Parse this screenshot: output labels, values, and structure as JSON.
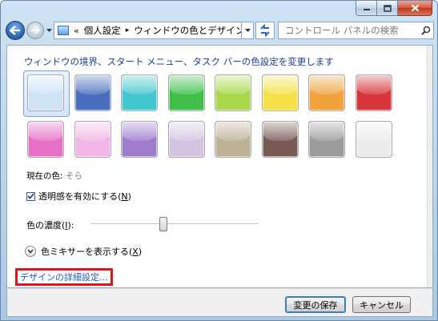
{
  "window": {
    "caption_buttons": [
      "minimize-icon",
      "maximize-icon",
      "close-icon"
    ]
  },
  "nav": {
    "breadcrumb_overflow": "«",
    "crumbs": [
      "個人設定",
      "ウィンドウの色とデザイン"
    ],
    "crumb_separator": "▸",
    "search_placeholder": "コントロール パネルの検索"
  },
  "content": {
    "heading": "ウィンドウの境界、スタート メニュー、タスク バーの色設定を変更します",
    "swatches": [
      {
        "name": "sky",
        "color": "#cfe3f7",
        "selected": true
      },
      {
        "name": "twilight",
        "color": "#4a6fc0"
      },
      {
        "name": "sea",
        "color": "#42c6cf"
      },
      {
        "name": "leaf",
        "color": "#3fbf4a"
      },
      {
        "name": "lime",
        "color": "#a8d84a"
      },
      {
        "name": "lemon",
        "color": "#f5e24a"
      },
      {
        "name": "orange",
        "color": "#f0a23c"
      },
      {
        "name": "ruby",
        "color": "#d7353b"
      },
      {
        "name": "fuchsia",
        "color": "#e76fc6"
      },
      {
        "name": "blush",
        "color": "#f1b6e6"
      },
      {
        "name": "violet",
        "color": "#9d7ccc"
      },
      {
        "name": "lavender",
        "color": "#d4c4e2"
      },
      {
        "name": "taupe",
        "color": "#bdb196"
      },
      {
        "name": "chocolate",
        "color": "#7a5a55"
      },
      {
        "name": "slate",
        "color": "#9b9b9b"
      },
      {
        "name": "frost",
        "color": "#ececec"
      }
    ],
    "current_color_label": "現在の色:",
    "current_color_value": "そら",
    "transparency_label": "透明感を有効にする(",
    "transparency_key": "N",
    "transparency_checked": true,
    "intensity_label": "色の濃度(",
    "intensity_key": "I",
    "intensity_level": 0.43,
    "mixer_label": "色ミキサーを表示する(",
    "mixer_key": "X",
    "advanced_link": "デザインの詳細設定..."
  },
  "footer": {
    "save_label": "変更の保存",
    "cancel_label": "キャンセル"
  },
  "colors": {
    "link": "#1a5fc7",
    "heading": "#1e3f96",
    "highlight_box": "#e0141b"
  }
}
